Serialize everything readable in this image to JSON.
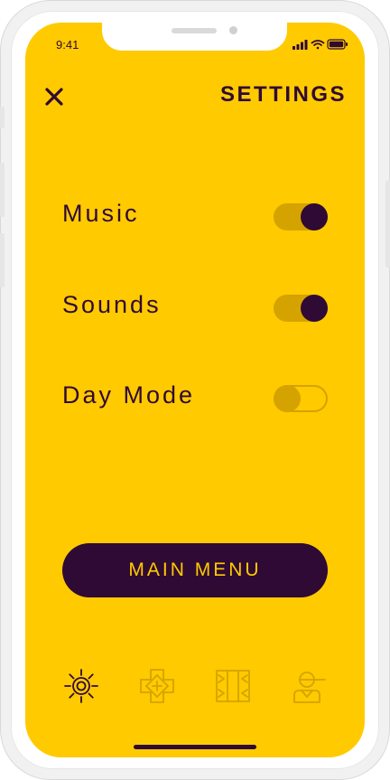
{
  "status_bar": {
    "time": "9:41"
  },
  "header": {
    "close_icon": "close-x-icon",
    "title": "SETTINGS"
  },
  "settings": [
    {
      "label": "Music",
      "enabled": true
    },
    {
      "label": "Sounds",
      "enabled": true
    },
    {
      "label": "Day Mode",
      "enabled": false
    }
  ],
  "main_menu_button": {
    "label": "MAIN MENU"
  },
  "tabbar": {
    "items": [
      {
        "icon": "sun-settings-icon",
        "active": true
      },
      {
        "icon": "dpad-plus-icon",
        "active": false
      },
      {
        "icon": "board-icon",
        "active": false
      },
      {
        "icon": "profile-icon",
        "active": false
      }
    ]
  },
  "colors": {
    "background": "#FFCA00",
    "primary": "#2f0a34",
    "muted": "#D4A300"
  }
}
